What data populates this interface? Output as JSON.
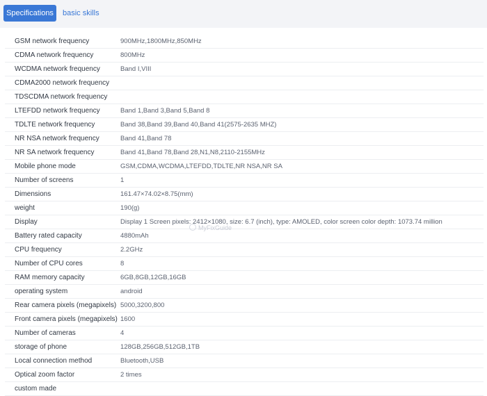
{
  "tabs": {
    "specifications": "Specifications",
    "basic_skills": "basic skills"
  },
  "specs": [
    {
      "label": "GSM network frequency",
      "value": "900MHz,1800MHz,850MHz"
    },
    {
      "label": "CDMA network frequency",
      "value": "800MHz"
    },
    {
      "label": "WCDMA network frequency",
      "value": "Band I,VIII"
    },
    {
      "label": "CDMA2000 network frequency",
      "value": ""
    },
    {
      "label": "TDSCDMA network frequency",
      "value": ""
    },
    {
      "label": "LTEFDD network frequency",
      "value": "Band 1,Band 3,Band 5,Band 8"
    },
    {
      "label": "TDLTE network frequency",
      "value": "Band 38,Band 39,Band 40,Band 41(2575-2635 MHZ)"
    },
    {
      "label": "NR NSA network frequency",
      "value": "Band 41,Band 78"
    },
    {
      "label": "NR SA network frequency",
      "value": "Band 41,Band 78,Band 28,N1,N8,2110-2155MHz"
    },
    {
      "label": "Mobile phone mode",
      "value": "GSM,CDMA,WCDMA,LTEFDD,TDLTE,NR NSA,NR SA"
    },
    {
      "label": "Number of screens",
      "value": "1"
    },
    {
      "label": "Dimensions",
      "value": "161.47×74.02×8.75(mm)"
    },
    {
      "label": "weight",
      "value": "190(g)"
    },
    {
      "label": "Display",
      "value": "Display 1 Screen pixels: 2412×1080, size: 6.7 (inch), type: AMOLED, color screen color depth: 1073.74 million"
    },
    {
      "label": "Battery rated capacity",
      "value": "4880mAh"
    },
    {
      "label": "CPU frequency",
      "value": "2.2GHz"
    },
    {
      "label": "Number of CPU cores",
      "value": "8"
    },
    {
      "label": "RAM memory capacity",
      "value": "6GB,8GB,12GB,16GB"
    },
    {
      "label": "operating system",
      "value": "android"
    },
    {
      "label": "Rear camera pixels (megapixels)",
      "value": "5000,3200,800"
    },
    {
      "label": "Front camera pixels (megapixels)",
      "value": "1600"
    },
    {
      "label": "Number of cameras",
      "value": "4"
    },
    {
      "label": "storage of phone",
      "value": "128GB,256GB,512GB,1TB"
    },
    {
      "label": "Local connection method",
      "value": "Bluetooth,USB"
    },
    {
      "label": "Optical zoom factor",
      "value": "2 times"
    },
    {
      "label": "custom made",
      "value": ""
    }
  ],
  "watermark": "MyFixGuide",
  "colors": {
    "accent": "#3a78d6",
    "tabbar_bg": "#f3f4f7",
    "label_text": "#333a45",
    "value_text": "#5b6270",
    "row_divider": "#eceef1"
  }
}
